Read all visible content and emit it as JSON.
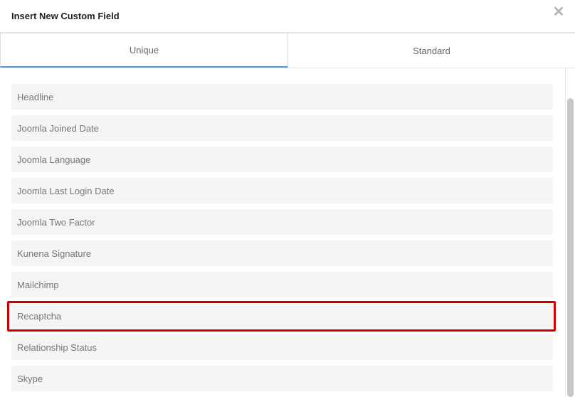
{
  "dialog": {
    "title": "Insert New Custom Field",
    "close_icon": "close-icon"
  },
  "tabs": [
    {
      "label": "Unique",
      "active": true
    },
    {
      "label": "Standard",
      "active": false
    }
  ],
  "fields": [
    {
      "label": "Headline"
    },
    {
      "label": "Joomla Joined Date"
    },
    {
      "label": "Joomla Language"
    },
    {
      "label": "Joomla Last Login Date"
    },
    {
      "label": "Joomla Two Factor"
    },
    {
      "label": "Kunena Signature"
    },
    {
      "label": "Mailchimp"
    },
    {
      "label": "Recaptcha",
      "highlighted": true
    },
    {
      "label": "Relationship Status"
    },
    {
      "label": "Skype"
    }
  ],
  "colors": {
    "highlight": "#cc0000",
    "active_tab_underline": "#5b9bd5"
  }
}
